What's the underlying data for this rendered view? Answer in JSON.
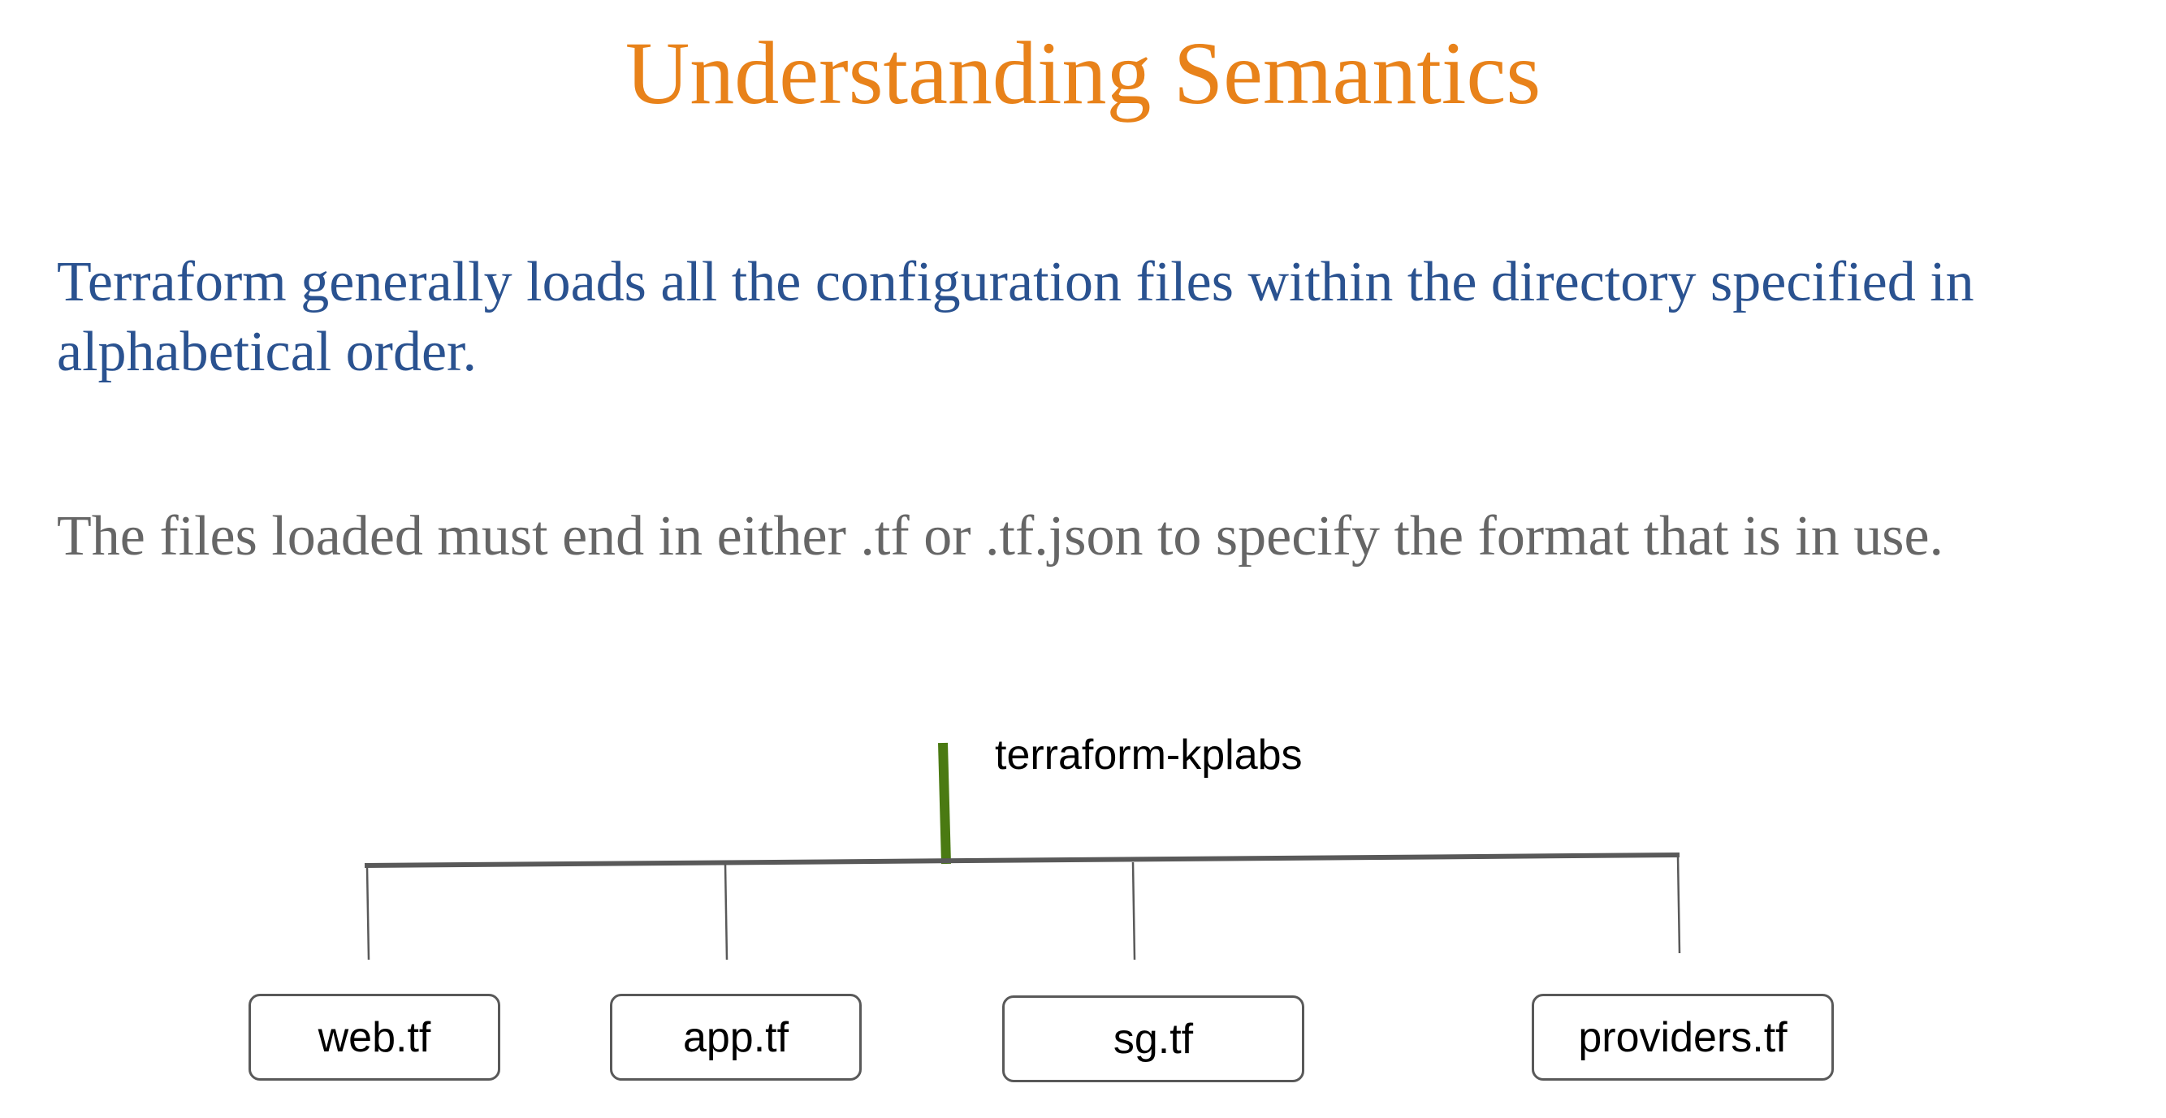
{
  "slide": {
    "title": "Understanding Semantics",
    "paragraph_1": "Terraform generally loads all the configuration files within the directory specified in alphabetical order.",
    "paragraph_2": "The files loaded must end in either .tf or .tf.json to specify the format that is in use."
  },
  "tree": {
    "root_label": "terraform-kplabs",
    "files": [
      "web.tf",
      "app.tf",
      "sg.tf",
      "providers.tf"
    ]
  },
  "colors": {
    "title": "#e8821a",
    "paragraph_1": "#2a5290",
    "paragraph_2": "#666666",
    "root_stem": "#4a7a12",
    "branch_lines": "#595959"
  }
}
